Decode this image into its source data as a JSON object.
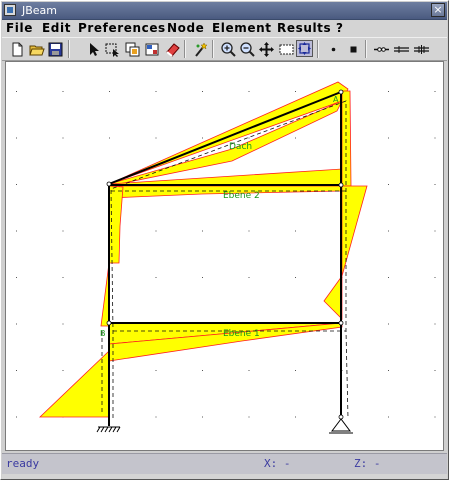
{
  "window": {
    "title": "JBeam",
    "close_glyph": "×"
  },
  "menu": [
    "File",
    "Edit",
    "Preferences",
    "Node",
    "Element",
    "Results",
    "?"
  ],
  "toolbar": {
    "buttons": [
      "new-file-icon",
      "open-folder-icon",
      "save-icon",
      "select-arrow-icon",
      "select-box-icon",
      "copy-icon",
      "properties-icon",
      "eraser-icon",
      "wand-icon",
      "zoom-in-icon",
      "zoom-out-icon",
      "pan-icon",
      "zoom-window-icon",
      "zoom-fit-icon",
      "node-point-icon",
      "node-square-icon",
      "hinge-icon",
      "beam-icon",
      "truss-icon"
    ]
  },
  "canvas": {
    "labels": {
      "roof": "Dach",
      "level2": "Ebene 2",
      "level1": "Ebene 1",
      "node_a": "A",
      "node_b": "B"
    },
    "colors": {
      "moment_fill": "#ffff00",
      "moment_edge": "#ff2020",
      "structure": "#000000",
      "labels": "#1a9a1a"
    }
  },
  "status": {
    "message": "ready",
    "x_label": "X: -",
    "z_label": "Z: -"
  }
}
